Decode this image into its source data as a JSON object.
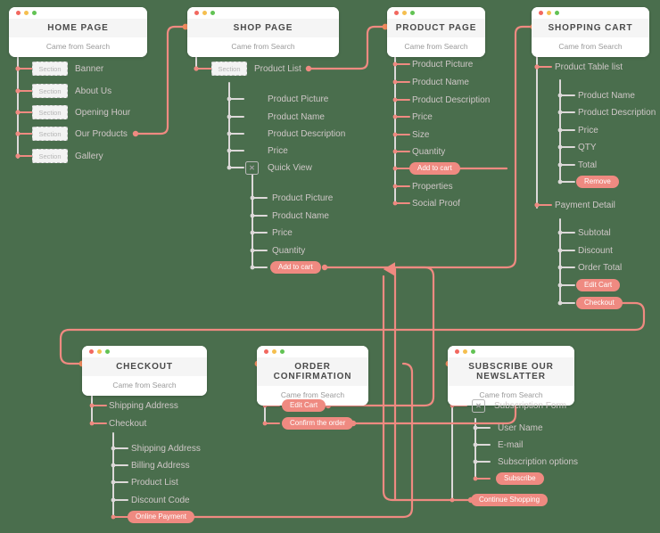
{
  "meta": {
    "subtitle": "Came from Search",
    "section_label": "Section",
    "x_glyph": "✕",
    "accent": "#ef8a81",
    "background": "#4a6e4d",
    "line_gray": "#d8d8d8",
    "text_gray": "#cfc7c7"
  },
  "pages": {
    "home": {
      "title": "HOME PAGE",
      "subtitle": "Came from Search",
      "items": [
        {
          "label": "Banner",
          "section": true
        },
        {
          "label": "About Us",
          "section": true
        },
        {
          "label": "Opening Hour",
          "section": true
        },
        {
          "label": "Our Products",
          "section": true
        },
        {
          "label": "Gallery",
          "section": true
        }
      ]
    },
    "shop": {
      "title": "SHOP PAGE",
      "subtitle": "Came from Search",
      "items": [
        {
          "label": "Product List",
          "section": true
        }
      ],
      "sub_items": [
        {
          "label": "Product Picture"
        },
        {
          "label": "Product Name"
        },
        {
          "label": "Product Description"
        },
        {
          "label": "Price"
        },
        {
          "label": "Quick View",
          "checkbox": true
        }
      ],
      "quick_view_items": [
        {
          "label": "Product Picture"
        },
        {
          "label": "Product Name"
        },
        {
          "label": "Price"
        },
        {
          "label": "Quantity"
        },
        {
          "label": "Add to cart",
          "pill": true
        }
      ]
    },
    "product": {
      "title": "PRODUCT PAGE",
      "subtitle": "Came from Search",
      "items": [
        {
          "label": "Product Picture"
        },
        {
          "label": "Product Name"
        },
        {
          "label": "Product Description"
        },
        {
          "label": "Price"
        },
        {
          "label": "Size"
        },
        {
          "label": "Quantity"
        },
        {
          "label": "Add to cart",
          "pill": true
        },
        {
          "label": "Properties"
        },
        {
          "label": "Social Proof"
        }
      ]
    },
    "cart": {
      "title": "SHOPPING CART",
      "subtitle": "Came from Search",
      "groups": [
        {
          "label": "Product Table list",
          "items": [
            {
              "label": "Product Name"
            },
            {
              "label": "Product Description"
            },
            {
              "label": "Price"
            },
            {
              "label": "QTY"
            },
            {
              "label": "Total"
            },
            {
              "label": "Remove",
              "pill": true
            }
          ]
        },
        {
          "label": "Payment Detail",
          "items": [
            {
              "label": "Subtotal"
            },
            {
              "label": "Discount"
            },
            {
              "label": "Order Total"
            },
            {
              "label": "Edit Cart",
              "pill": true
            },
            {
              "label": "Checkout",
              "pill": true
            }
          ]
        }
      ]
    },
    "checkout": {
      "title": "CHECKOUT",
      "subtitle": "Came from Search",
      "items": [
        {
          "label": "Shipping Address"
        },
        {
          "label": "Checkout"
        }
      ],
      "sub_items": [
        {
          "label": "Shipping Address"
        },
        {
          "label": "Billing Address"
        },
        {
          "label": "Product List"
        },
        {
          "label": "Discount Code"
        },
        {
          "label": "Online Payment",
          "pill": true
        }
      ]
    },
    "confirmation": {
      "title": "ORDER CONFIRMATION",
      "subtitle": "Came from Search",
      "items": [
        {
          "label": "Edit Cart",
          "pill": true
        },
        {
          "label": "Confirm the order",
          "pill": true
        }
      ]
    },
    "newsletter": {
      "title": "SUBSCRIBE OUR NEWSLATTER",
      "subtitle": "Came from Search",
      "items": [
        {
          "label": "Subscription Form",
          "checkbox": true
        },
        {
          "label": "Continue Shopping",
          "pill": true
        }
      ],
      "sub_items": [
        {
          "label": "User Name"
        },
        {
          "label": "E-mail"
        },
        {
          "label": "Subscription options"
        },
        {
          "label": "Subscribe",
          "pill": true
        }
      ]
    }
  }
}
